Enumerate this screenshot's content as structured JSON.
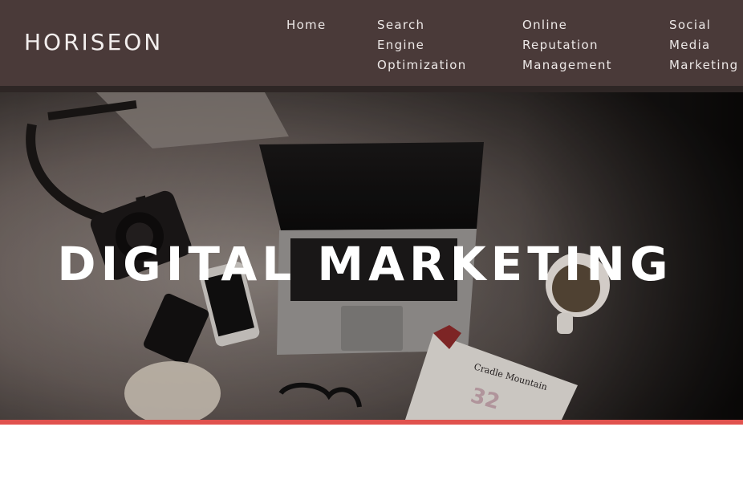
{
  "header": {
    "logo": "HORISEON",
    "nav": [
      {
        "label": "Home"
      },
      {
        "label": "Search\nEngine\nOptimization"
      },
      {
        "label": "Online\nReputation\nManagement"
      },
      {
        "label": "Social\nMedia\nMarketing"
      }
    ]
  },
  "hero": {
    "title": "DIGITAL MARKETING",
    "magazine_text": "Cradle Mountain",
    "magazine_number": "32"
  },
  "colors": {
    "header_bg": "#4a3a39",
    "accent": "#e0524e",
    "hero_text": "#ffffff"
  }
}
